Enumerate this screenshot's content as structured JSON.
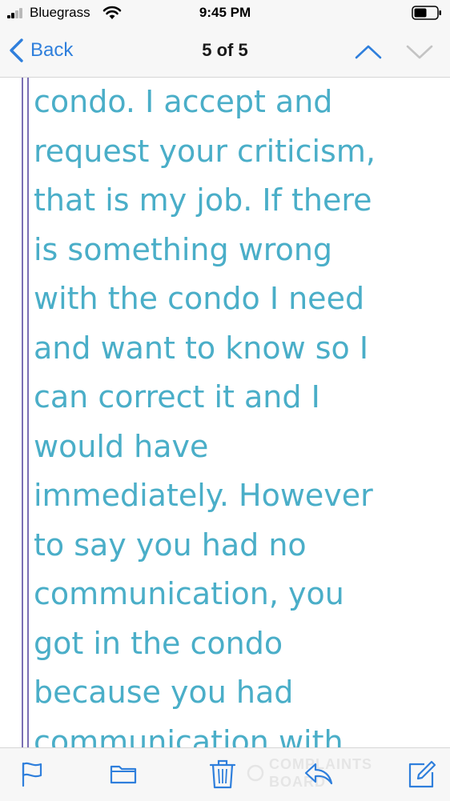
{
  "status_bar": {
    "carrier": "Bluegrass",
    "time": "9:45 PM",
    "signal_icon": "signal-bars-icon",
    "wifi_icon": "wifi-icon",
    "battery_icon": "battery-icon"
  },
  "nav": {
    "back_label": "Back",
    "counter": "5 of 5",
    "up_icon": "chevron-up-icon",
    "down_icon": "chevron-down-icon"
  },
  "message": {
    "lines": [
      "condo.  I accept and",
      "request your criticism,",
      "that is my job.  If there",
      "is something wrong",
      "with the condo I need",
      "and want to know so I",
      "can correct it and I",
      "would have",
      "immediately.   However",
      "to say you had no",
      "communication,  you",
      "got in the condo",
      "because you had",
      "communication with"
    ]
  },
  "toolbar": {
    "flag_icon": "flag-icon",
    "folder_icon": "folder-icon",
    "trash_icon": "trash-icon",
    "reply_icon": "reply-icon",
    "compose_icon": "compose-icon",
    "watermark_line1": "COMPLAINTS",
    "watermark_line2": "BOARD"
  },
  "colors": {
    "accent": "#2f7fdc",
    "body_text": "#4aaec8",
    "quote_bar": "#7a6fb3",
    "bar_background": "#f7f7f7"
  }
}
